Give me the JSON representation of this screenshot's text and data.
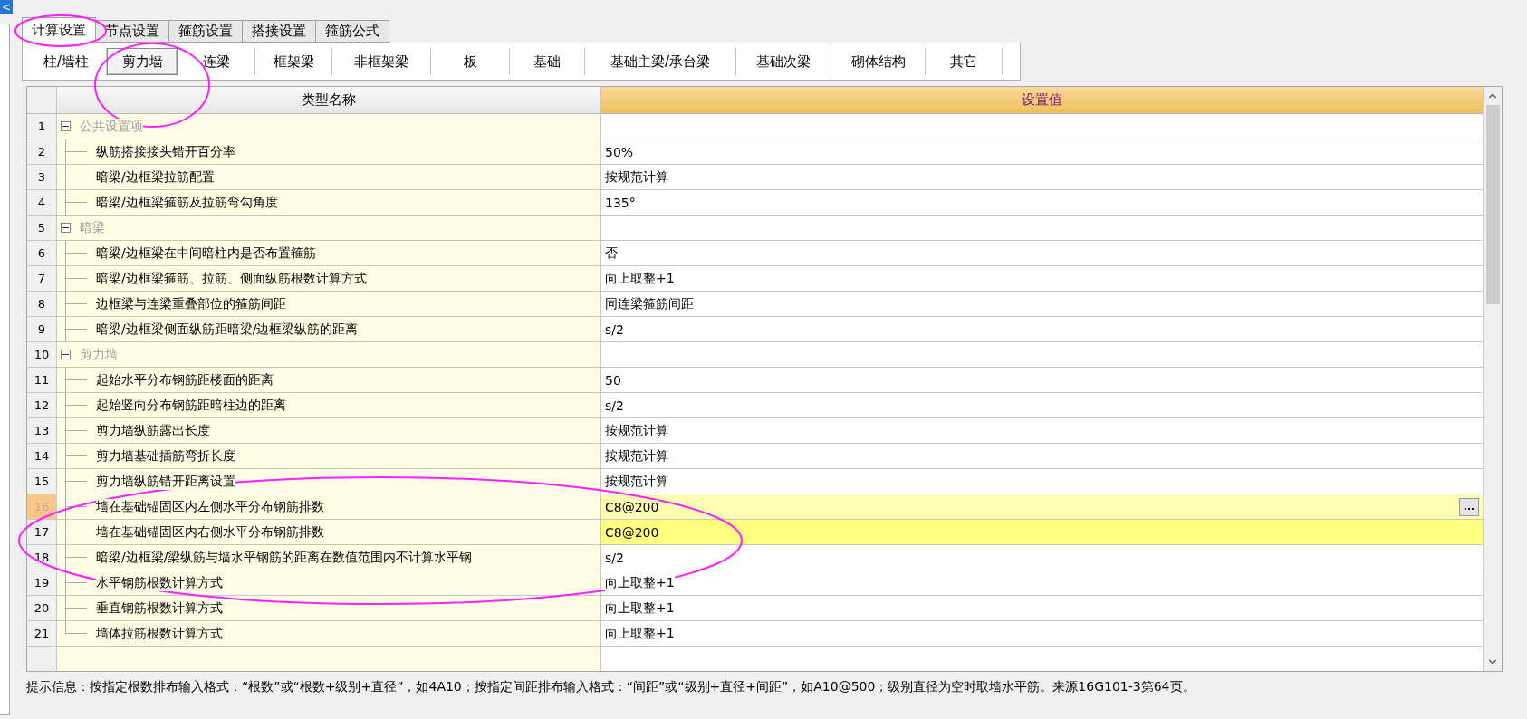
{
  "left_panel": {
    "collapse_button": "<"
  },
  "tabs": [
    {
      "label": "计算设置",
      "selected": true
    },
    {
      "label": "节点设置",
      "selected": false
    },
    {
      "label": "箍筋设置",
      "selected": false
    },
    {
      "label": "搭接设置",
      "selected": false
    },
    {
      "label": "箍筋公式",
      "selected": false
    }
  ],
  "subtabs": [
    {
      "label": "柱/墙柱",
      "selected": false
    },
    {
      "label": "剪力墙",
      "selected": true
    },
    {
      "label": "连梁",
      "selected": false
    },
    {
      "label": "框架梁",
      "selected": false
    },
    {
      "label": "非框架梁",
      "selected": false
    },
    {
      "label": "板",
      "selected": false
    },
    {
      "label": "基础",
      "selected": false
    },
    {
      "label": "基础主梁/承台梁",
      "selected": false
    },
    {
      "label": "基础次梁",
      "selected": false
    },
    {
      "label": "砌体结构",
      "selected": false
    },
    {
      "label": "其它",
      "selected": false
    }
  ],
  "table": {
    "columns": [
      "类型名称",
      "设置值"
    ],
    "edit_button": "...",
    "groups": [
      {
        "number": "1",
        "label": "公共设置项",
        "expanded": true,
        "children": [
          {
            "number": "2",
            "name": "纵筋搭接接头错开百分率",
            "value": "50%",
            "selected": false,
            "highlighted": false
          },
          {
            "number": "3",
            "name": "暗梁/边框梁拉筋配置",
            "value": "按规范计算",
            "selected": false,
            "highlighted": false
          },
          {
            "number": "4",
            "name": "暗梁/边框梁箍筋及拉筋弯勾角度",
            "value": "135°",
            "selected": false,
            "highlighted": false
          }
        ]
      },
      {
        "number": "5",
        "label": "暗梁",
        "expanded": true,
        "children": [
          {
            "number": "6",
            "name": "暗梁/边框梁在中间暗柱内是否布置箍筋",
            "value": "否",
            "selected": false,
            "highlighted": false
          },
          {
            "number": "7",
            "name": "暗梁/边框梁箍筋、拉筋、侧面纵筋根数计算方式",
            "value": "向上取整+1",
            "selected": false,
            "highlighted": false
          },
          {
            "number": "8",
            "name": "边框梁与连梁重叠部位的箍筋间距",
            "value": "同连梁箍筋间距",
            "selected": false,
            "highlighted": false
          },
          {
            "number": "9",
            "name": "暗梁/边框梁侧面纵筋距暗梁/边框梁纵筋的距离",
            "value": "s/2",
            "selected": false,
            "highlighted": false
          }
        ]
      },
      {
        "number": "10",
        "label": "剪力墙",
        "expanded": true,
        "children": [
          {
            "number": "11",
            "name": "起始水平分布钢筋距楼面的距离",
            "value": "50",
            "selected": false,
            "highlighted": false
          },
          {
            "number": "12",
            "name": "起始竖向分布钢筋距暗柱边的距离",
            "value": "s/2",
            "selected": false,
            "highlighted": false
          },
          {
            "number": "13",
            "name": "剪力墙纵筋露出长度",
            "value": "按规范计算",
            "selected": false,
            "highlighted": false
          },
          {
            "number": "14",
            "name": "剪力墙基础插筋弯折长度",
            "value": "按规范计算",
            "selected": false,
            "highlighted": false
          },
          {
            "number": "15",
            "name": "剪力墙纵筋错开距离设置",
            "value": "按规范计算",
            "selected": false,
            "highlighted": false
          },
          {
            "number": "16",
            "name": "墙在基础锚固区内左侧水平分布钢筋排数",
            "value": "C8@200",
            "selected": true,
            "highlighted": false
          },
          {
            "number": "17",
            "name": "墙在基础锚固区内右侧水平分布钢筋排数",
            "value": "C8@200",
            "selected": false,
            "highlighted": true
          },
          {
            "number": "18",
            "name": "暗梁/边框梁/梁纵筋与墙水平钢筋的距离在数值范围内不计算水平钢",
            "value": "s/2",
            "selected": false,
            "highlighted": false
          },
          {
            "number": "19",
            "name": "水平钢筋根数计算方式",
            "value": "向上取整+1",
            "selected": false,
            "highlighted": false
          },
          {
            "number": "20",
            "name": "垂直钢筋根数计算方式",
            "value": "向上取整+1",
            "selected": false,
            "highlighted": false
          },
          {
            "number": "21",
            "name": "墙体拉筋根数计算方式",
            "value": "向上取整+1",
            "selected": false,
            "highlighted": false
          }
        ]
      }
    ]
  },
  "hint": "提示信息：按指定根数排布输入格式：“根数”或“根数+级别+直径”，如4A10；按指定间距排布输入格式：“间距”或“级别+直径+间距”，如A10@500；级别直径为空时取墙水平筋。来源16G101-3第64页。"
}
